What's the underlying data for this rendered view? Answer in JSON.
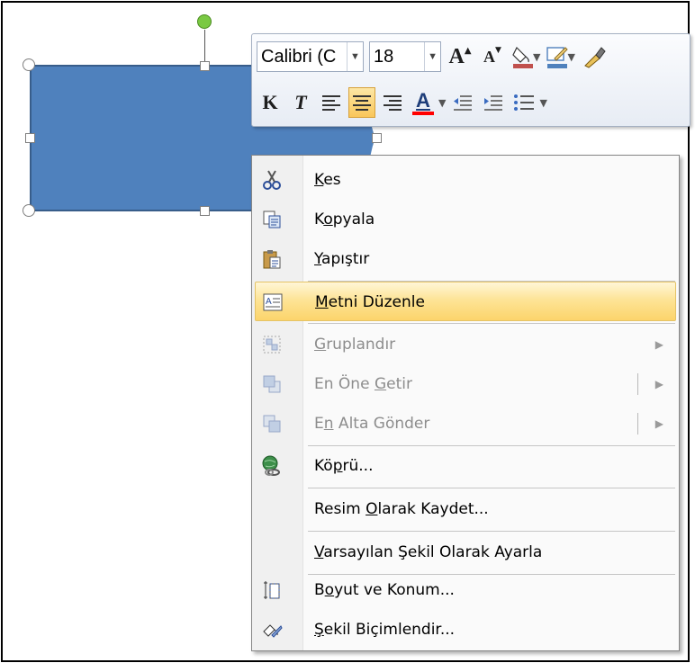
{
  "mini_toolbar": {
    "font_name": "Calibri (C",
    "font_size": "18",
    "grow_font_label": "A",
    "shrink_font_label": "A",
    "bold_label": "K",
    "italic_label": "T",
    "font_color_label": "A",
    "colors": {
      "fill_swatch": "#c0504d",
      "line_swatch": "#4f81bd",
      "font_color_swatch": "#ff0000"
    }
  },
  "shape": {
    "fill": "#4f81bd",
    "border": "#385d8a"
  },
  "context_menu": {
    "items": [
      {
        "pre": "",
        "key": "K",
        "post": "es",
        "icon": "scissors-icon",
        "enabled": true
      },
      {
        "pre": "K",
        "key": "o",
        "post": "pyala",
        "icon": "copy-icon",
        "enabled": true
      },
      {
        "pre": "",
        "key": "Y",
        "post": "apıştır",
        "icon": "paste-icon",
        "enabled": true
      },
      {
        "pre": "",
        "key": "M",
        "post": "etni Düzenle",
        "icon": "edit-text-icon",
        "enabled": true,
        "highlighted": true
      },
      {
        "pre": "",
        "key": "G",
        "post": "ruplandır",
        "icon": "group-icon",
        "enabled": false,
        "submenu": true
      },
      {
        "pre": "En Öne ",
        "key": "G",
        "post": "etir",
        "icon": "bring-to-front-icon",
        "enabled": false,
        "submenu": true,
        "split": true
      },
      {
        "pre": "E",
        "key": "n",
        "post": " Alta Gönder",
        "icon": "send-to-back-icon",
        "enabled": false,
        "submenu": true,
        "split": true
      },
      {
        "pre": "Kö",
        "key": "p",
        "post": "rü...",
        "icon": "hyperlink-icon",
        "enabled": true
      },
      {
        "pre": "Resim ",
        "key": "O",
        "post": "larak Kaydet...",
        "icon": "",
        "enabled": true
      },
      {
        "pre": "",
        "key": "V",
        "post": "arsayılan Şekil Olarak Ayarla",
        "icon": "",
        "enabled": true
      },
      {
        "pre": "B",
        "key": "o",
        "post": "yut ve Konum...",
        "icon": "size-position-icon",
        "enabled": true
      },
      {
        "pre": "",
        "key": "Ş",
        "post": "ekil Biçimlendir...",
        "icon": "format-shape-icon",
        "enabled": true
      }
    ]
  }
}
